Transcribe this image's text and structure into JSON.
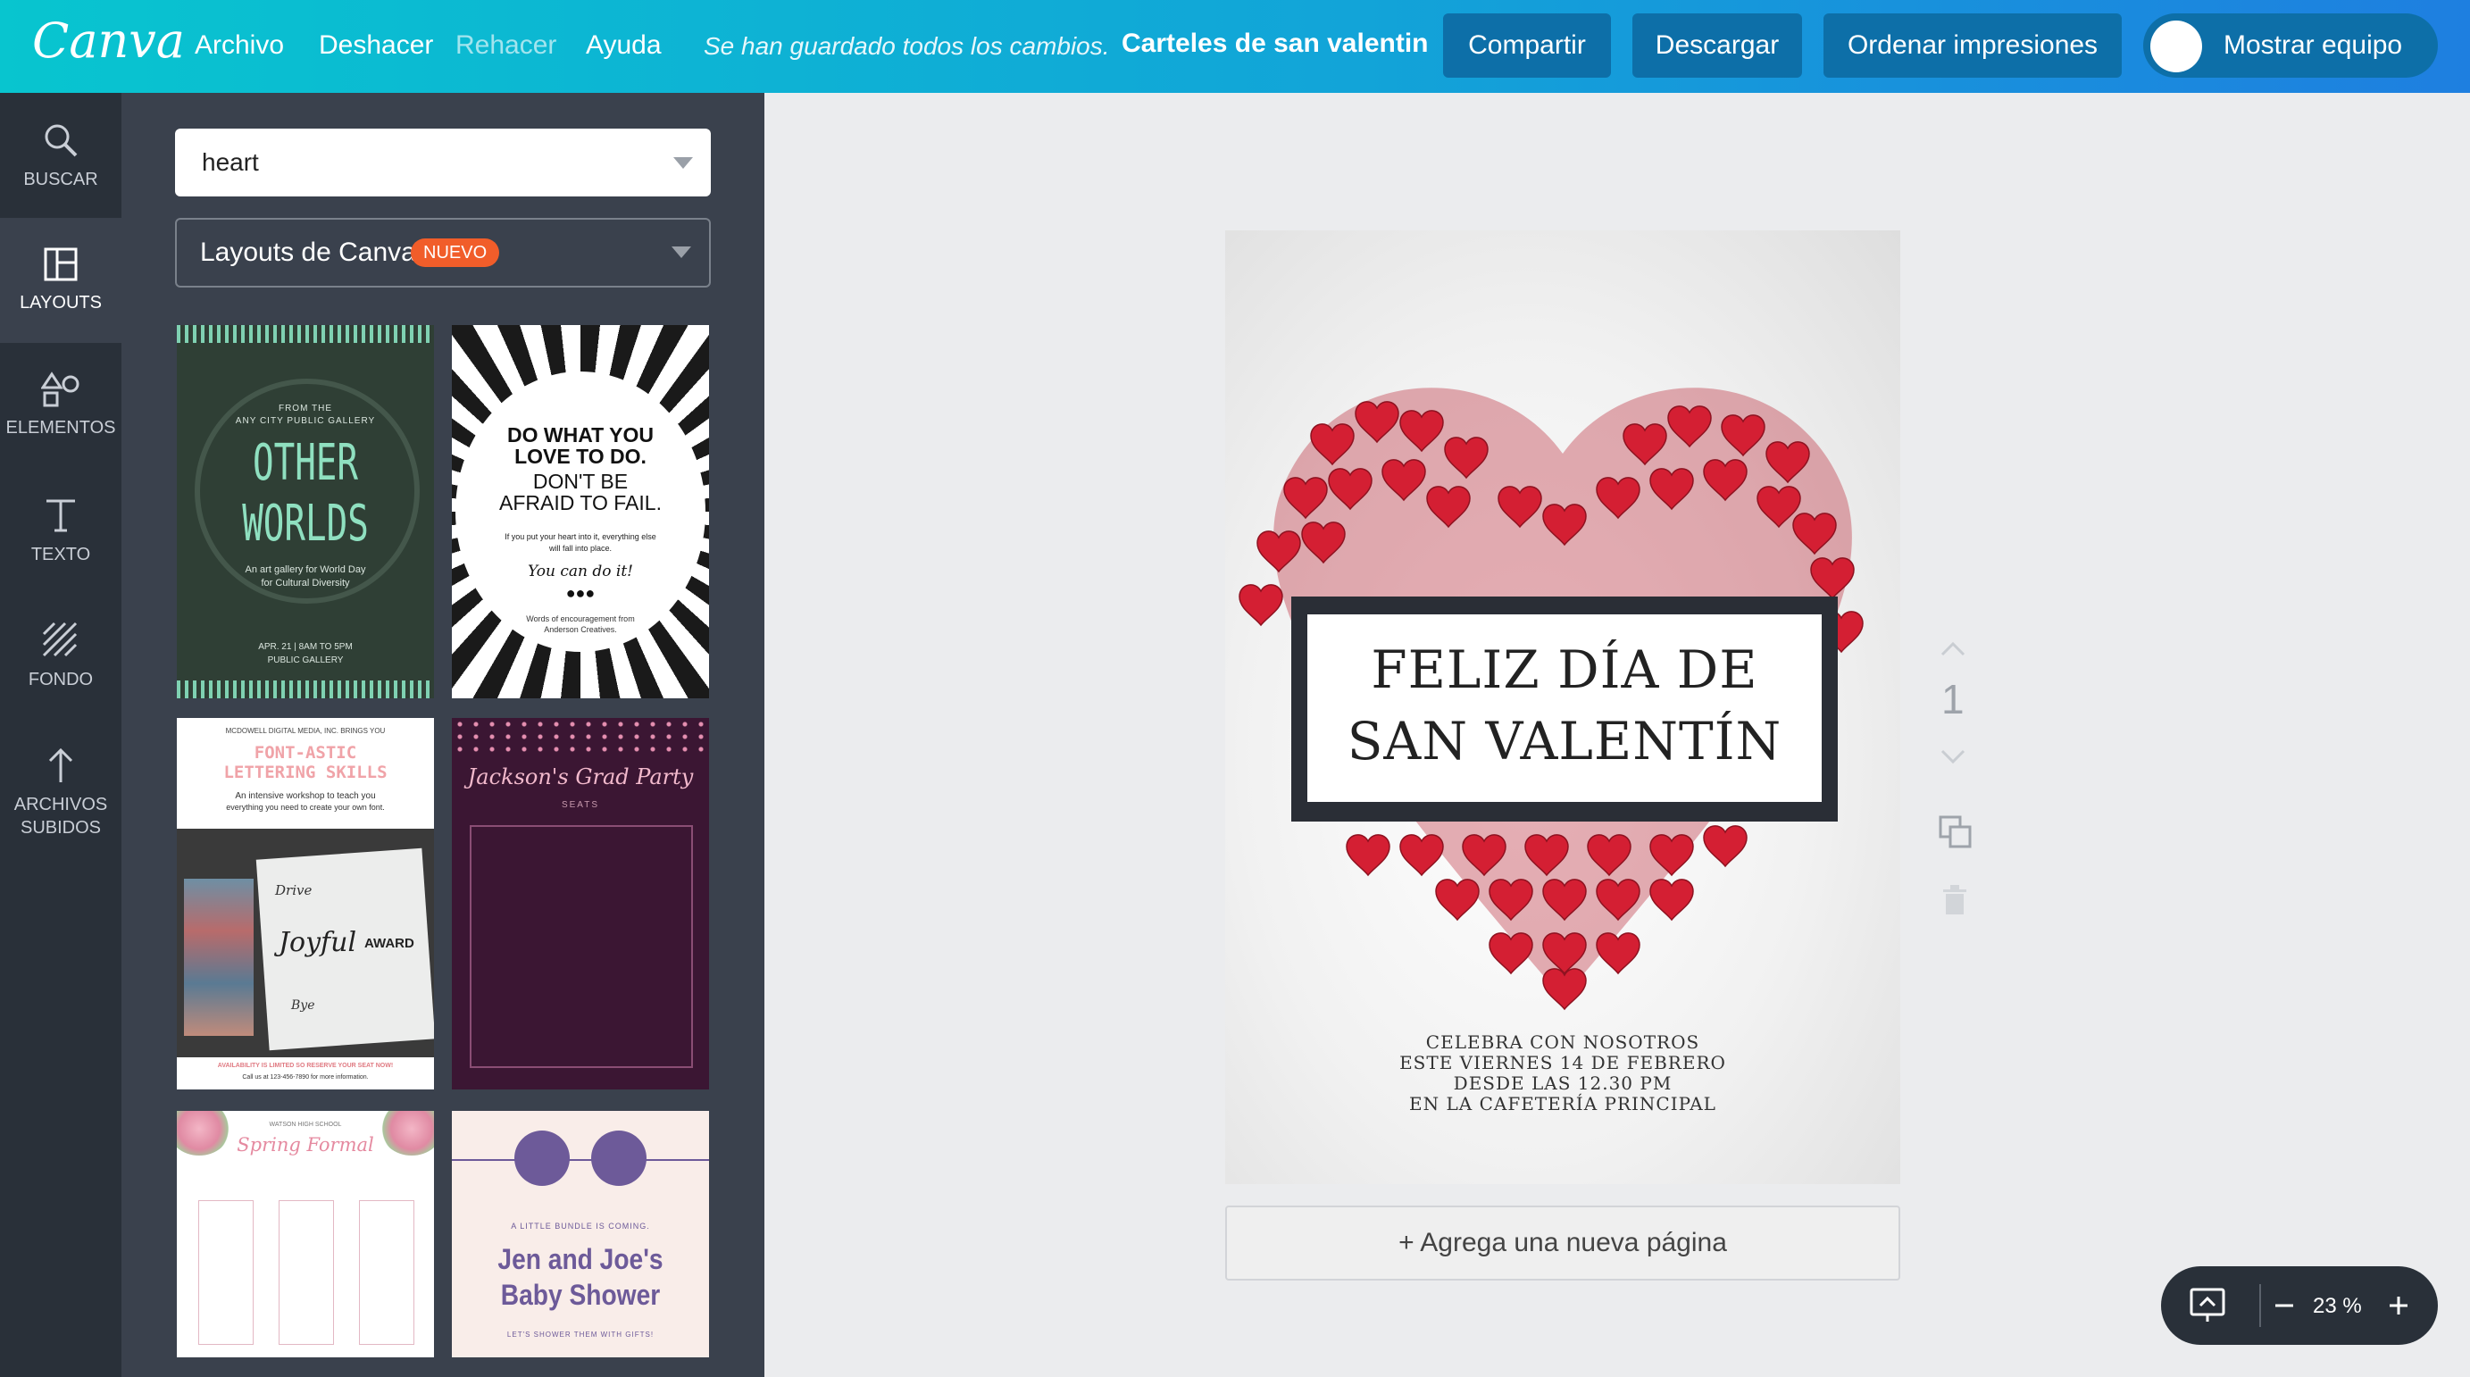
{
  "topbar": {
    "logo": "Canva",
    "menu": [
      "Archivo",
      "Deshacer",
      "Rehacer",
      "Ayuda"
    ],
    "saved_status": "Se han guardado todos los cambios.",
    "doc_title": "Carteles de san valentin",
    "share": "Compartir",
    "download": "Descargar",
    "order_prints": "Ordenar impresiones",
    "show_team": "Mostrar equipo"
  },
  "sidebar": {
    "items": [
      {
        "label": "BUSCAR",
        "icon": "search-icon"
      },
      {
        "label": "LAYOUTS",
        "icon": "layouts-icon"
      },
      {
        "label": "ELEMENTOS",
        "icon": "elements-icon"
      },
      {
        "label": "TEXTO",
        "icon": "text-icon"
      },
      {
        "label": "FONDO",
        "icon": "background-icon"
      },
      {
        "label_1": "ARCHIVOS",
        "label_2": "SUBIDOS",
        "icon": "upload-icon"
      }
    ]
  },
  "panel": {
    "search_value": "heart",
    "layout_source": "Layouts de Canva",
    "new_badge": "NUEVO",
    "templates": [
      {
        "top": "FROM THE",
        "top2": "ANY CITY PUBLIC GALLERY",
        "title_1": "OTHER",
        "title_2": "WORLDS",
        "sub_1": "An art gallery for World Day",
        "sub_2": "for Cultural Diversity",
        "date": "APR. 21 | 8AM TO 5PM",
        "venue": "PUBLIC GALLERY"
      },
      {
        "title_1": "DO WHAT YOU",
        "title_2": "LOVE TO DO.",
        "title_3": "DON'T BE",
        "title_4": "AFRAID TO FAIL.",
        "sub_1": "If you put your heart into it, everything else",
        "sub_2": "will fall into place.",
        "script": "You can do it!",
        "foot_1": "Words of encouragement from",
        "foot_2": "Anderson Creatives."
      },
      {
        "top": "MCDOWELL DIGITAL MEDIA, INC. BRINGS YOU",
        "title_1": "FONT-ASTIC",
        "title_2": "LETTERING SKILLS",
        "sub_1": "An intensive workshop to teach you",
        "sub_2": "everything you need to create your own font.",
        "words": [
          "Joyful",
          "AWARD",
          "Drive",
          "Bye"
        ],
        "foot_1": "AVAILABILITY IS LIMITED SO RESERVE YOUR SEAT NOW!",
        "foot_2": "Call us at 123-456-7890 for more information."
      },
      {
        "title": "Jackson's Grad Party",
        "sub": "SEATS"
      },
      {
        "top": "WATSON HIGH SCHOOL",
        "title": "Spring Formal"
      },
      {
        "top": "A LITTLE BUNDLE IS COMING.",
        "title_1": "Jen and Joe's",
        "title_2": "Baby Shower",
        "foot": "LET'S SHOWER THEM WITH GIFTS!"
      }
    ]
  },
  "canvas": {
    "title_1": "FELIZ DÍA DE",
    "title_2": "SAN VALENTÍN",
    "details": [
      "CELEBRA CON NOSOTROS",
      "ESTE VIERNES 14 DE FEBRERO",
      "DESDE LAS 12.30 PM",
      "EN LA CAFETERÍA PRINCIPAL"
    ],
    "add_page": "+ Agrega una nueva página",
    "page_number": "1"
  },
  "zoom": {
    "value": "23 %"
  },
  "colors": {
    "accent_left": "#08c5cf",
    "accent_right": "#1e7fe0",
    "button": "#0d6fa8",
    "rail": "#293039",
    "panel": "#3a414d",
    "heart": "#d41f33",
    "badge": "#f15d2a"
  }
}
